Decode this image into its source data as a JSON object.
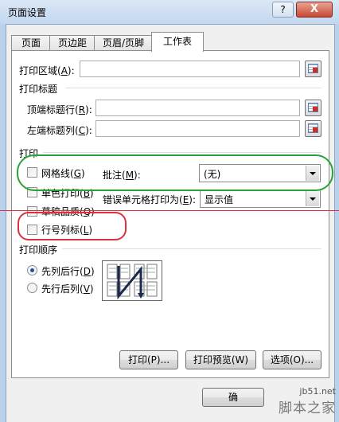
{
  "window": {
    "title": "页面设置",
    "help_glyph": "?",
    "close_glyph": "X"
  },
  "tabs": [
    {
      "label": "页面",
      "active": false
    },
    {
      "label": "页边距",
      "active": false
    },
    {
      "label": "页眉/页脚",
      "active": false
    },
    {
      "label": "工作表",
      "active": true
    }
  ],
  "print_area": {
    "label": "打印区域(",
    "key": "A",
    "suffix": "):",
    "value": ""
  },
  "print_titles": {
    "heading": "打印标题",
    "top_row": {
      "label": "顶端标题行(",
      "key": "R",
      "suffix": "):",
      "value": ""
    },
    "left_col": {
      "label": "左端标题列(",
      "key": "C",
      "suffix": "):",
      "value": ""
    }
  },
  "print": {
    "heading": "打印",
    "gridlines": {
      "label": "网格线(",
      "key": "G",
      "suffix": ")",
      "checked": false
    },
    "black_white": {
      "label": "单色打印(",
      "key": "B",
      "suffix": ")",
      "checked": false
    },
    "draft": {
      "label": "草稿品质(",
      "key": "Q",
      "suffix": ")",
      "checked": false
    },
    "row_col_headings": {
      "label": "行号列标(",
      "key": "L",
      "suffix": ")",
      "checked": false
    },
    "comments": {
      "label": "批注(",
      "key": "M",
      "suffix": "):",
      "value": "(无)"
    },
    "cell_errors": {
      "label": "错误单元格打印为(",
      "key": "E",
      "suffix": "):",
      "value": "显示值"
    }
  },
  "page_order": {
    "heading": "打印顺序",
    "down_then_over": {
      "label": "先列后行(",
      "key": "D",
      "suffix": ")",
      "selected": true
    },
    "over_then_down": {
      "label": "先行后列(",
      "key": "V",
      "suffix": ")",
      "selected": false
    }
  },
  "buttons": {
    "print": "打印(P)...",
    "preview": "打印预览(W)",
    "options": "选项(O)...",
    "ok": "确"
  },
  "watermark": {
    "site": "jb51.net",
    "name": "脚本之家"
  },
  "colors": {
    "green_annotation": "#2aa23a",
    "red_annotation": "#d9343e",
    "accent": "#1f4fa8"
  }
}
